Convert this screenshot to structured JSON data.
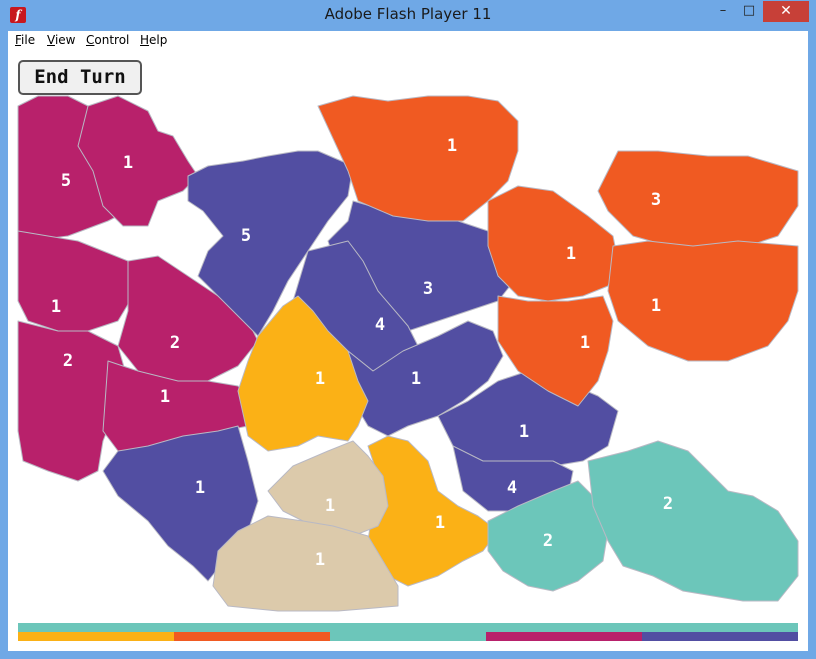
{
  "window": {
    "title": "Adobe Flash Player 11",
    "app_icon": "flash-icon",
    "min_glyph": "–",
    "max_glyph": "□",
    "close_glyph": "✕"
  },
  "menu": [
    "File",
    "View",
    "Control",
    "Help"
  ],
  "game": {
    "end_turn_label": "End Turn",
    "regions": [
      {
        "owner": "magenta",
        "dice": "5"
      },
      {
        "owner": "magenta",
        "dice": "1"
      },
      {
        "owner": "magenta",
        "dice": "1"
      },
      {
        "owner": "magenta",
        "dice": "2"
      },
      {
        "owner": "magenta",
        "dice": "2"
      },
      {
        "owner": "magenta",
        "dice": "1"
      },
      {
        "owner": "indigo",
        "dice": "5"
      },
      {
        "owner": "indigo",
        "dice": "3"
      },
      {
        "owner": "indigo",
        "dice": "4"
      },
      {
        "owner": "indigo",
        "dice": "1"
      },
      {
        "owner": "indigo",
        "dice": "1"
      },
      {
        "owner": "indigo",
        "dice": "1"
      },
      {
        "owner": "indigo",
        "dice": "4"
      },
      {
        "owner": "orange",
        "dice": "1"
      },
      {
        "owner": "orange",
        "dice": "3"
      },
      {
        "owner": "orange",
        "dice": "1"
      },
      {
        "owner": "orange",
        "dice": "1"
      },
      {
        "owner": "orange",
        "dice": "1"
      },
      {
        "owner": "yellow",
        "dice": "1"
      },
      {
        "owner": "yellow",
        "dice": "1"
      },
      {
        "owner": "beige",
        "dice": "1"
      },
      {
        "owner": "beige",
        "dice": "1"
      },
      {
        "owner": "teal",
        "dice": "2"
      },
      {
        "owner": "teal",
        "dice": "2"
      }
    ],
    "players": [
      {
        "name": "yellow",
        "color": "#fbb116",
        "share": 0.2
      },
      {
        "name": "orange",
        "color": "#f05a22",
        "share": 0.2
      },
      {
        "name": "teal",
        "color": "#6cc6ba",
        "share": 0.2
      },
      {
        "name": "magenta",
        "color": "#b8216b",
        "share": 0.2
      },
      {
        "name": "indigo",
        "color": "#524ea2",
        "share": 0.2
      }
    ],
    "active_player_color": "#6cc6ba"
  },
  "colors": {
    "magenta": "#b8216b",
    "indigo": "#524ea2",
    "orange": "#f05a22",
    "yellow": "#fbb116",
    "beige": "#dccaab",
    "teal": "#6cc6ba"
  }
}
